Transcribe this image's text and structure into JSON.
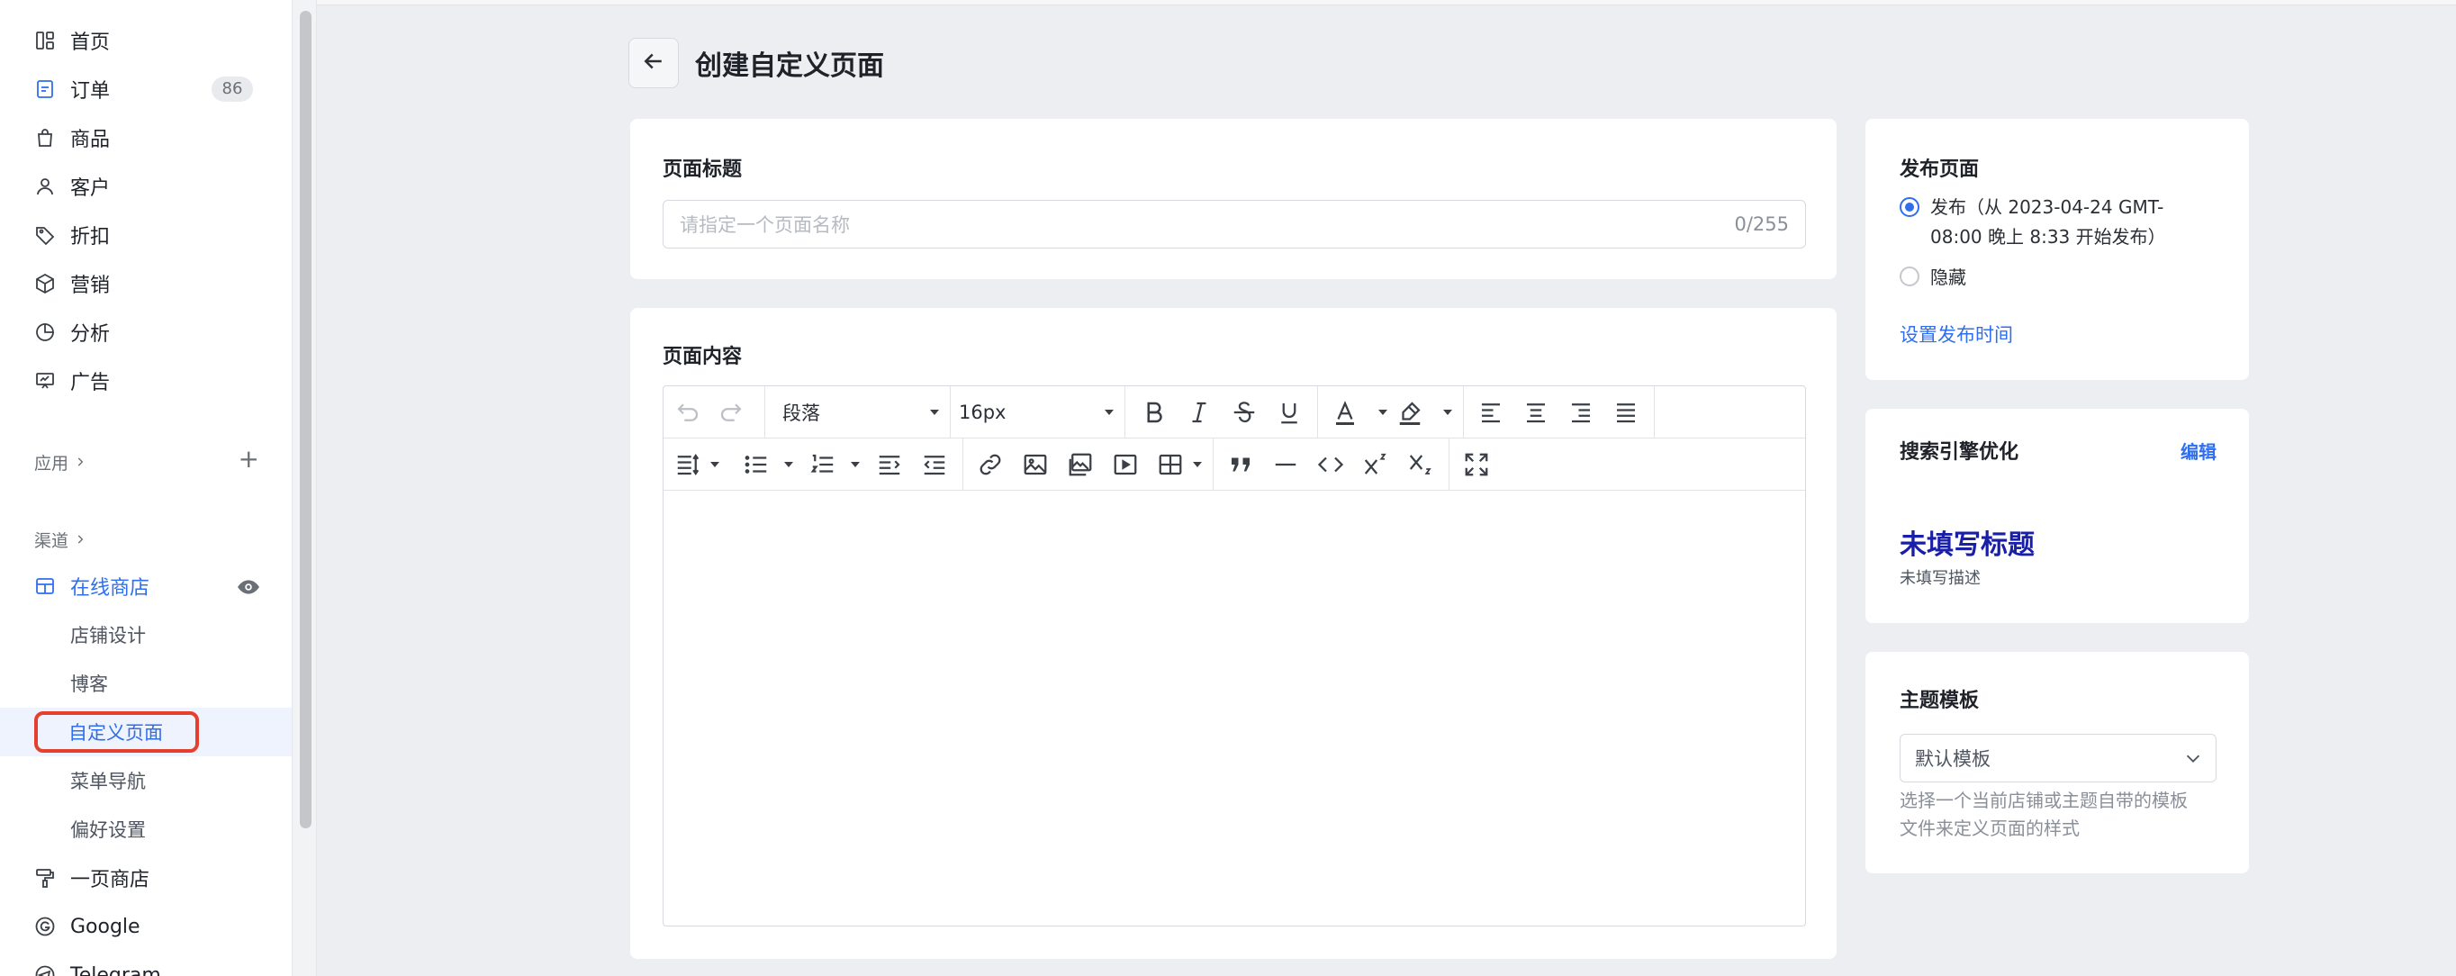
{
  "sidebar": {
    "items": [
      {
        "label": "首页",
        "icon": "dashboard-icon"
      },
      {
        "label": "订单",
        "icon": "order-icon",
        "badge": "86"
      },
      {
        "label": "商品",
        "icon": "bag-icon"
      },
      {
        "label": "客户",
        "icon": "user-icon"
      },
      {
        "label": "折扣",
        "icon": "tag-icon"
      },
      {
        "label": "营销",
        "icon": "box-icon"
      },
      {
        "label": "分析",
        "icon": "pie-chart-icon"
      },
      {
        "label": "广告",
        "icon": "presentation-icon"
      }
    ],
    "apps_label": "应用",
    "channels_label": "渠道",
    "online_store": {
      "label": "在线商店",
      "icon": "store-icon"
    },
    "sub_items": [
      "店铺设计",
      "博客",
      "自定义页面",
      "菜单导航",
      "偏好设置"
    ],
    "bottom_items": [
      {
        "label": "一页商店",
        "icon": "paint-roller-icon"
      },
      {
        "label": "Google",
        "icon": "google-icon"
      },
      {
        "label": "Telegram",
        "icon": "telegram-icon"
      }
    ],
    "accent_color": "#2f6fed",
    "highlight_color": "#e5402d"
  },
  "header": {
    "title": "创建自定义页面"
  },
  "title_card": {
    "label": "页面标题",
    "placeholder": "请指定一个页面名称",
    "counter": "0/255"
  },
  "content_card": {
    "label": "页面内容",
    "toolbar": {
      "paragraph_select": "段落",
      "font_size_select": "16px"
    }
  },
  "publish_card": {
    "title": "发布页面",
    "option_publish": "发布（从 2023-04-24 GMT-08:00 晚上 8:33 开始发布）",
    "option_publish_line1": "发布（从 2023-04-24 GMT-",
    "option_publish_line2": "08:00 晚上 8:33 开始发布）",
    "option_hide": "隐藏",
    "schedule_link": "设置发布时间"
  },
  "seo_card": {
    "title": "搜索引擎优化",
    "edit_link": "编辑",
    "preview_title": "未填写标题",
    "preview_desc": "未填写描述"
  },
  "template_card": {
    "title": "主题模板",
    "selected": "默认模板",
    "help_line1": "选择一个当前店铺或主题自带的模板",
    "help_line2": "文件来定义页面的样式"
  }
}
